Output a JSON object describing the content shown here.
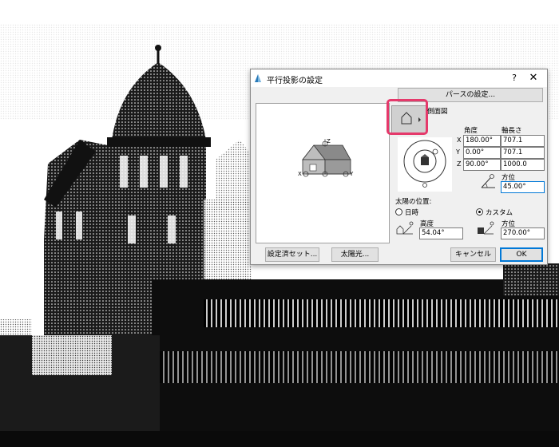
{
  "dialog": {
    "title": "平行投影の設定",
    "help_label": "?",
    "close_label": "✕",
    "perspective_settings_label": "パースの設定...",
    "view_type_label": "側面図",
    "headers": {
      "angle": "角度",
      "axis_length": "軸長さ"
    },
    "axes": [
      {
        "axis": "X",
        "angle": "180.00°",
        "length": "707.1"
      },
      {
        "axis": "Y",
        "angle": "0.00°",
        "length": "707.1"
      },
      {
        "axis": "Z",
        "angle": "90.00°",
        "length": "1000.0"
      }
    ],
    "direction": {
      "label": "方位",
      "value": "45.00°"
    },
    "sun": {
      "section_label": "太陽の位置:",
      "option_datetime": "日時",
      "option_custom": "カスタム",
      "selected": "カスタム",
      "altitude_label": "高度",
      "altitude_value": "54.04°",
      "azimuth_label": "方位",
      "azimuth_value": "270.00°"
    },
    "preview_axes": {
      "x": "X",
      "y": "Y",
      "z": "Z"
    },
    "buttons": {
      "presets": "設定済セット...",
      "sunlight": "太陽光...",
      "cancel": "キャンセル",
      "ok": "OK"
    },
    "accent_color": "#0078d7",
    "highlight_color": "#e5396b"
  }
}
